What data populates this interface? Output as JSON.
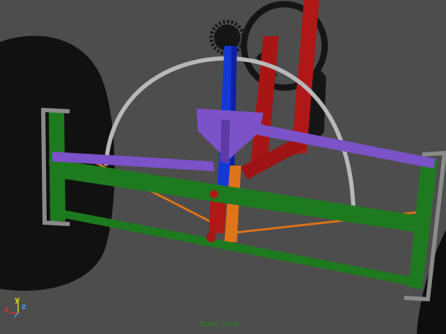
{
  "viewport": {
    "camera_name": "front_view",
    "background_color": "#4d4d4d",
    "hud_color": "#1f8a1f"
  },
  "axis_gizmo": {
    "x_label": "x",
    "y_label": "y",
    "z_label": "z",
    "x_color": "#e03030",
    "y_color": "#d8d820",
    "z_color": "#3aa0ff"
  },
  "scene_colors": {
    "tire": "#111111",
    "axle_frame": "#1e7a1e",
    "tie_rod": "#7b52c7",
    "steering_column": "#1438d8",
    "frame_posts": "#b01818",
    "link_rods": "#e07418",
    "arc_guide": "#b8b8b8",
    "steering_wheel": "#151515",
    "spindle_brackets": "#8a8a8a"
  }
}
